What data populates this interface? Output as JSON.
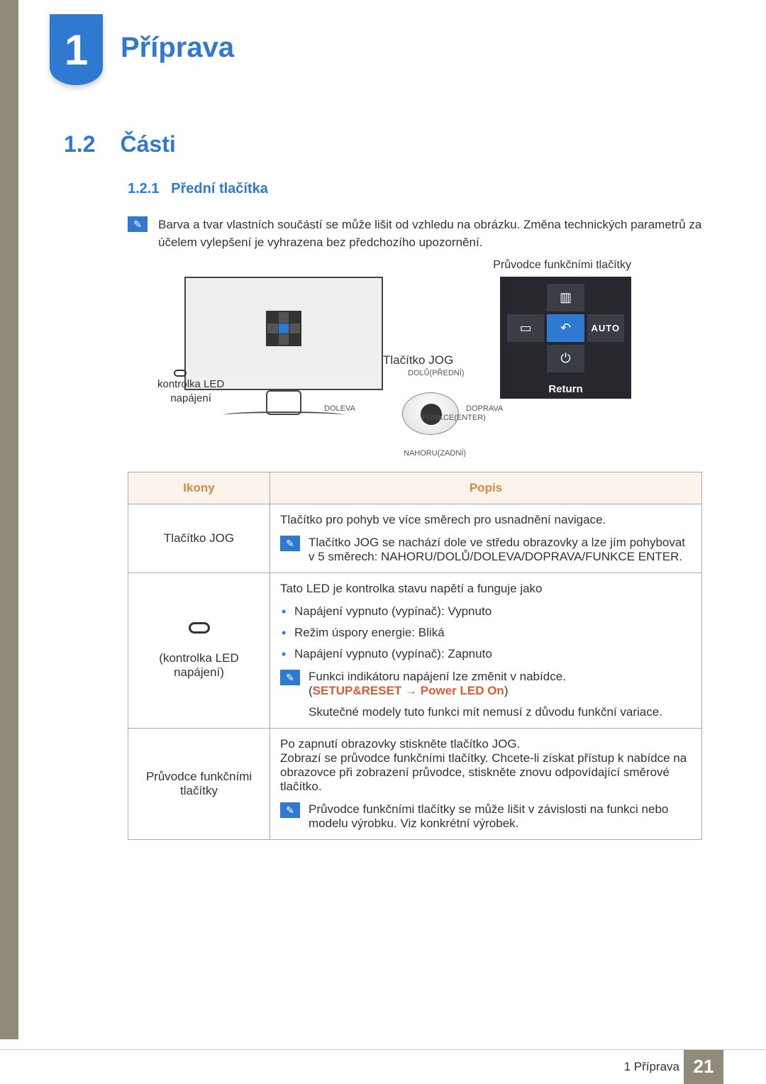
{
  "chapter": {
    "number": "1",
    "title": "Příprava"
  },
  "section": {
    "number": "1.2",
    "title": "Části"
  },
  "subsection": {
    "number": "1.2.1",
    "title": "Přední tlačítka"
  },
  "intro_note": "Barva a tvar vlastních součástí se může lišit od vzhledu na obrázku. Změna technických parametrů za účelem vylepšení je vyhrazena bez předchozího upozornění.",
  "figure": {
    "guide_label": "Průvodce funkčními tlačítky",
    "return_label": "Return",
    "auto_label": "AUTO",
    "led_label_line1": "kontrolka LED",
    "led_label_line2": "napájení",
    "jog_label": "Tlačítko JOG",
    "jog_directions": {
      "up": "DOLŮ(PŘEDNÍ)",
      "left": "DOLEVA",
      "right": "DOPRAVA",
      "center": "FUNKCE(ENTER)",
      "down": "NAHORU(ZADNÍ)"
    }
  },
  "table": {
    "head_icons": "Ikony",
    "head_desc": "Popis",
    "row1": {
      "icon_label": "Tlačítko JOG",
      "text1": "Tlačítko pro pohyb ve více směrech pro usnadnění navigace.",
      "note": "Tlačítko JOG se nachází dole ve středu obrazovky a lze jím pohybovat v 5 směrech: NAHORU/DOLŮ/DOLEVA/DOPRAVA/FUNKCE ENTER."
    },
    "row2": {
      "icon_label": "(kontrolka LED napájení)",
      "text1": "Tato LED je kontrolka stavu napětí a funguje jako",
      "bullets": [
        "Napájení vypnuto (vypínač): Vypnuto",
        "Režim úspory energie: Bliká",
        "Napájení vypnuto (vypínač): Zapnuto"
      ],
      "note_line1": "Funkci indikátoru napájení lze změnit v nabídce.",
      "setup_path": "SETUP&RESET → Power LED On",
      "note_line2": "Skutečné modely tuto funkci mít nemusí z důvodu funkční variace."
    },
    "row3": {
      "icon_label": "Průvodce funkčními tlačítky",
      "text1": "Po zapnutí obrazovky stiskněte tlačítko JOG.",
      "text2": "Zobrazí se průvodce funkčními tlačítky. Chcete-li získat přístup k nabídce na obrazovce při zobrazení průvodce, stiskněte znovu odpovídající směrové tlačítko.",
      "note": "Průvodce funkčními tlačítky se může lišit v závislosti na funkci nebo modelu výrobku. Viz konkrétní výrobek."
    }
  },
  "footer": {
    "text": "1 Příprava",
    "page": "21"
  }
}
